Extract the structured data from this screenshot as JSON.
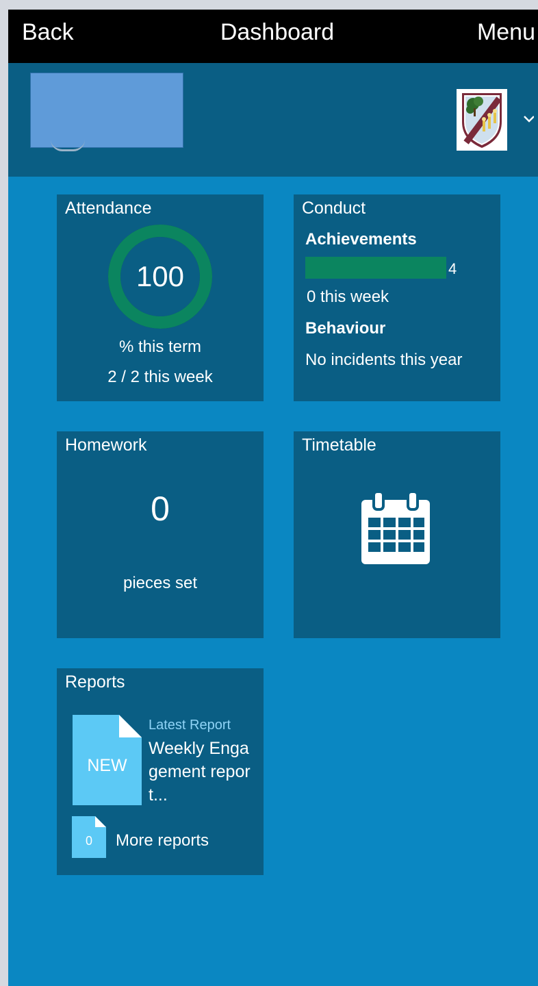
{
  "header": {
    "back_label": "Back",
    "title": "Dashboard",
    "menu_label": "Menu"
  },
  "profile": {
    "crest_icon": "school-crest-icon",
    "dropdown_icon": "chevron-down-icon"
  },
  "colors": {
    "app_bg": "#0a87c2",
    "tile_bg": "#0a5e84",
    "header_bg": "#000000",
    "success_green": "#0b855f",
    "report_light_blue": "#5cc9f5"
  },
  "attendance": {
    "title": "Attendance",
    "percent": "100",
    "percent_fraction": 1.0,
    "term_label": "% this term",
    "week_label": "2 / 2 this week"
  },
  "conduct": {
    "title": "Conduct",
    "achievements_label": "Achievements",
    "achievements_count": "4",
    "achievements_bar_fraction": 1.0,
    "achievements_week": "0 this week",
    "behaviour_label": "Behaviour",
    "behaviour_text": "No incidents this year"
  },
  "homework": {
    "title": "Homework",
    "count": "0",
    "label": "pieces set"
  },
  "timetable": {
    "title": "Timetable",
    "icon": "calendar-icon"
  },
  "reports": {
    "title": "Reports",
    "doc_badge": "NEW",
    "latest_label": "Latest Report",
    "latest_name": "Weekly Engagement report...",
    "more_count": "0",
    "more_label": "More reports",
    "doc_icon": "document-icon"
  }
}
